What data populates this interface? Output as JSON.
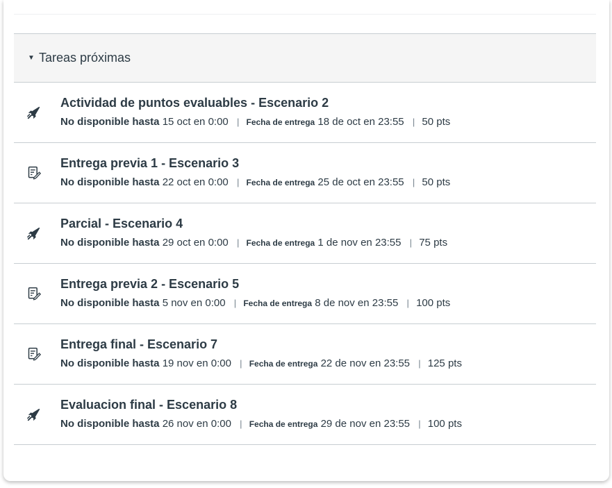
{
  "section": {
    "title": "Tareas próximas",
    "items": [
      {
        "icon": "quiz-rocket-icon",
        "title": "Actividad de puntos evaluables - Escenario 2",
        "unavailable_label": "No disponible hasta",
        "unavailable_value": "15 oct en 0:00",
        "due_label": "Fecha de entrega",
        "due_value": "18 de oct en 23:55",
        "points": "50 pts"
      },
      {
        "icon": "assignment-icon",
        "title": "Entrega previa 1 - Escenario 3",
        "unavailable_label": "No disponible hasta",
        "unavailable_value": "22 oct en 0:00",
        "due_label": "Fecha de entrega",
        "due_value": "25 de oct en 23:55",
        "points": "50 pts"
      },
      {
        "icon": "quiz-rocket-icon",
        "title": "Parcial - Escenario 4",
        "unavailable_label": "No disponible hasta",
        "unavailable_value": "29 oct en 0:00",
        "due_label": "Fecha de entrega",
        "due_value": "1 de nov en 23:55",
        "points": "75 pts"
      },
      {
        "icon": "assignment-icon",
        "title": "Entrega previa 2 - Escenario 5",
        "unavailable_label": "No disponible hasta",
        "unavailable_value": "5 nov en 0:00",
        "due_label": "Fecha de entrega",
        "due_value": "8 de nov en 23:55",
        "points": "100 pts"
      },
      {
        "icon": "assignment-icon",
        "title": "Entrega final - Escenario 7",
        "unavailable_label": "No disponible hasta",
        "unavailable_value": "19 nov en 0:00",
        "due_label": "Fecha de entrega",
        "due_value": "22 de nov en 23:55",
        "points": "125 pts"
      },
      {
        "icon": "quiz-rocket-icon",
        "title": "Evaluacion final - Escenario 8",
        "unavailable_label": "No disponible hasta",
        "unavailable_value": "26 nov en 0:00",
        "due_label": "Fecha de entrega",
        "due_value": "29 de nov en 23:55",
        "points": "100 pts"
      }
    ]
  }
}
